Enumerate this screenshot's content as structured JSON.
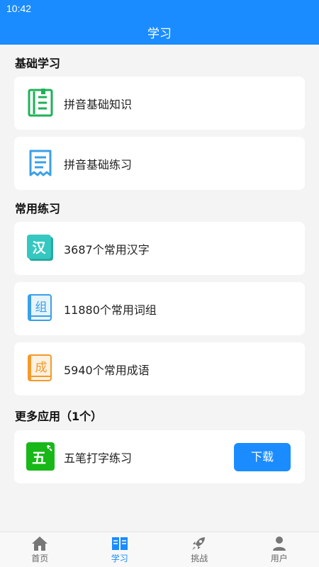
{
  "status": {
    "time": "10:42"
  },
  "header": {
    "title": "学习"
  },
  "sections": {
    "basic": {
      "title": "基础学习"
    },
    "common": {
      "title": "常用练习"
    },
    "more": {
      "title": "更多应用（1个）"
    }
  },
  "items": {
    "pinyin_knowledge": "拼音基础知识",
    "pinyin_practice": "拼音基础练习",
    "common_chars": "3687个常用汉字",
    "common_words": "11880个常用词组",
    "common_idioms": "5940个常用成语",
    "wubi": "五笔打字练习"
  },
  "icons": {
    "common_chars_glyph": "汉",
    "common_words_glyph": "组",
    "common_idioms_glyph": "成",
    "wubi_glyph": "五"
  },
  "download_label": "下载",
  "tabs": [
    {
      "label": "首页",
      "icon": "home-icon",
      "active": false
    },
    {
      "label": "学习",
      "icon": "book-icon",
      "active": true
    },
    {
      "label": "挑战",
      "icon": "rocket-icon",
      "active": false
    },
    {
      "label": "用户",
      "icon": "user-icon",
      "active": false
    }
  ],
  "colors": {
    "accent": "#1a8cff",
    "green": "#1fb158",
    "teal": "#35c8c0",
    "sky": "#3aa0e8",
    "orange": "#f39a2b",
    "wubi_green": "#18b818"
  }
}
